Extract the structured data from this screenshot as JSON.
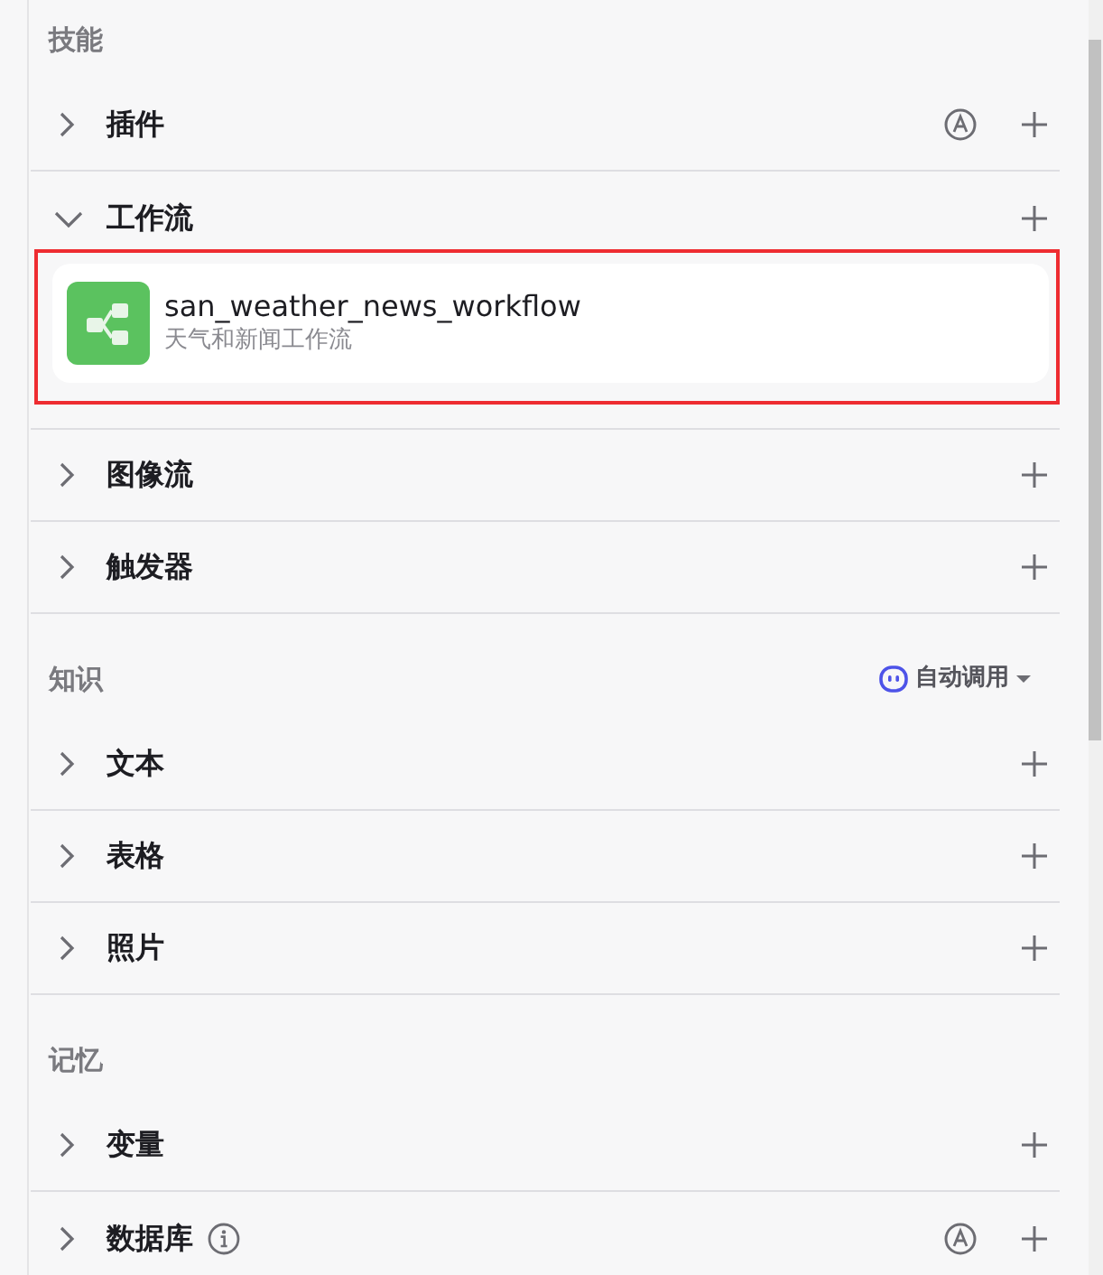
{
  "sections": [
    {
      "title": "技能",
      "rows": [
        {
          "label": "插件",
          "expanded": false,
          "info": false,
          "auto": true,
          "add": true
        },
        {
          "label": "工作流",
          "expanded": true,
          "info": false,
          "auto": false,
          "add": true,
          "children": [
            {
              "name": "san_weather_news_workflow",
              "description": "天气和新闻工作流",
              "highlighted": true
            }
          ]
        },
        {
          "label": "图像流",
          "expanded": false,
          "info": false,
          "auto": false,
          "add": true
        },
        {
          "label": "触发器",
          "expanded": false,
          "info": false,
          "auto": false,
          "add": true
        }
      ]
    },
    {
      "title": "知识",
      "mode": "自动调用",
      "rows": [
        {
          "label": "文本",
          "expanded": false,
          "info": false,
          "auto": false,
          "add": true
        },
        {
          "label": "表格",
          "expanded": false,
          "info": false,
          "auto": false,
          "add": true
        },
        {
          "label": "照片",
          "expanded": false,
          "info": false,
          "auto": false,
          "add": true
        }
      ]
    },
    {
      "title": "记忆",
      "rows": [
        {
          "label": "变量",
          "expanded": false,
          "info": false,
          "auto": false,
          "add": true
        },
        {
          "label": "数据库",
          "expanded": false,
          "info": true,
          "auto": true,
          "add": true
        }
      ]
    }
  ]
}
